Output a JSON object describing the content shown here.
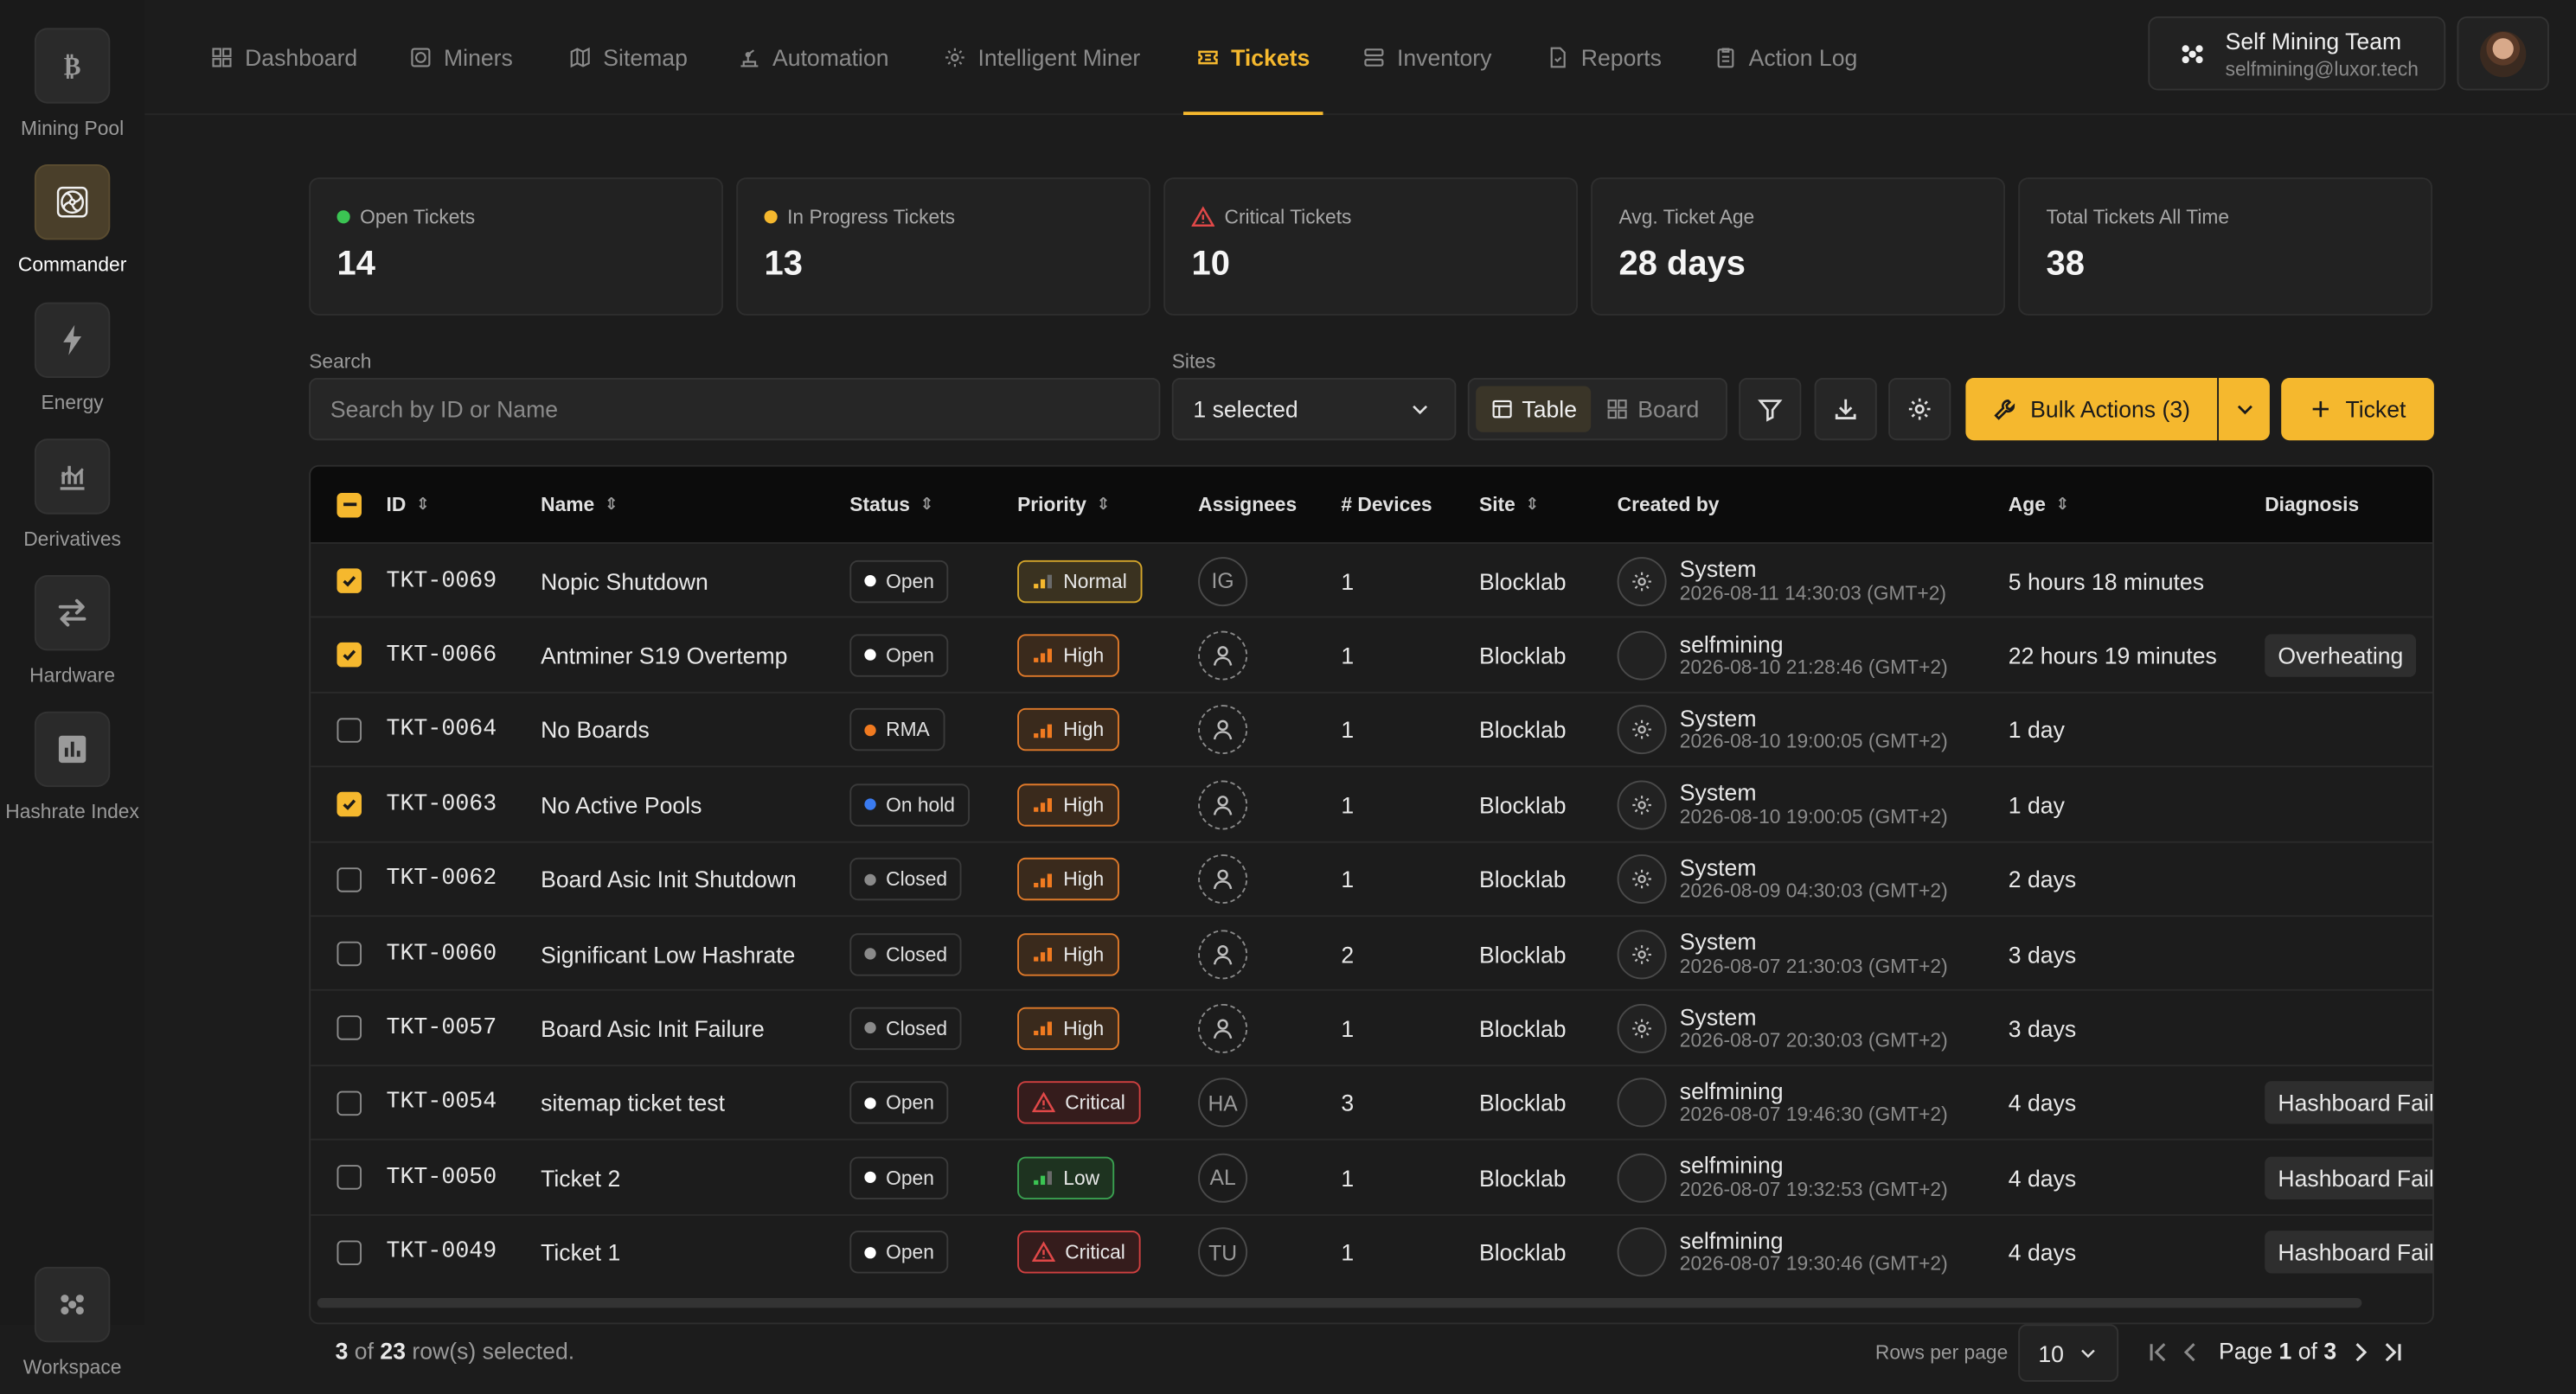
{
  "sidebar": {
    "items": [
      {
        "label": "Mining Pool",
        "icon": "bitcoin-icon"
      },
      {
        "label": "Commander",
        "icon": "fan-icon",
        "active": true
      },
      {
        "label": "Energy",
        "icon": "lightning-icon"
      },
      {
        "label": "Derivatives",
        "icon": "derivatives-chart-icon"
      },
      {
        "label": "Hardware",
        "icon": "swap-arrows-icon"
      },
      {
        "label": "Hashrate Index",
        "icon": "bar-chart-icon"
      }
    ],
    "workspace_label": "Workspace"
  },
  "nav": {
    "items": [
      "Dashboard",
      "Miners",
      "Sitemap",
      "Automation",
      "Intelligent Miner",
      "Tickets",
      "Inventory",
      "Reports",
      "Action Log"
    ],
    "active": "Tickets"
  },
  "account": {
    "team": "Self Mining Team",
    "email": "selfmining@luxor.tech"
  },
  "stats": [
    {
      "label": "Open Tickets",
      "value": "14",
      "color": "#3bc453"
    },
    {
      "label": "In Progress Tickets",
      "value": "13",
      "color": "#f5b82e"
    },
    {
      "label": "Critical Tickets",
      "value": "10",
      "color": "#e04848"
    },
    {
      "label": "Avg. Ticket Age",
      "value": "28 days"
    },
    {
      "label": "Total Tickets All Time",
      "value": "38"
    }
  ],
  "filters": {
    "search_label": "Search",
    "search_placeholder": "Search by ID or Name",
    "search_value": "",
    "sites_label": "Sites",
    "sites_value": "1 selected"
  },
  "toolbar": {
    "view_table": "Table",
    "view_board": "Board",
    "bulk_actions": "Bulk Actions (3)",
    "new_ticket": "Ticket"
  },
  "table": {
    "columns": [
      "ID",
      "Name",
      "Status",
      "Priority",
      "Assignees",
      "# Devices",
      "Site",
      "Created by",
      "Age",
      "Diagnosis"
    ],
    "rows": [
      {
        "checked": true,
        "id": "TKT-0069",
        "name": "Nopic Shutdown",
        "status": "Open",
        "priority": "Normal",
        "assignee": "IG",
        "devices": "1",
        "site": "Blocklab",
        "creator": "System",
        "created": "2026-08-11 14:30:03 (GMT+2)",
        "age": "5 hours 18 minutes",
        "diagnosis": ""
      },
      {
        "checked": true,
        "id": "TKT-0066",
        "name": "Antminer S19 Overtemp",
        "status": "Open",
        "priority": "High",
        "assignee": "",
        "devices": "1",
        "site": "Blocklab",
        "creator": "selfmining",
        "created": "2026-08-10 21:28:46 (GMT+2)",
        "age": "22 hours 19 minutes",
        "diagnosis": "Overheating"
      },
      {
        "checked": false,
        "id": "TKT-0064",
        "name": "No Boards",
        "status": "RMA",
        "priority": "High",
        "assignee": "",
        "devices": "1",
        "site": "Blocklab",
        "creator": "System",
        "created": "2026-08-10 19:00:05 (GMT+2)",
        "age": "1 day",
        "diagnosis": ""
      },
      {
        "checked": true,
        "id": "TKT-0063",
        "name": "No Active Pools",
        "status": "On hold",
        "priority": "High",
        "assignee": "",
        "devices": "1",
        "site": "Blocklab",
        "creator": "System",
        "created": "2026-08-10 19:00:05 (GMT+2)",
        "age": "1 day",
        "diagnosis": ""
      },
      {
        "checked": false,
        "id": "TKT-0062",
        "name": "Board Asic Init Shutdown",
        "status": "Closed",
        "priority": "High",
        "assignee": "",
        "devices": "1",
        "site": "Blocklab",
        "creator": "System",
        "created": "2026-08-09 04:30:03 (GMT+2)",
        "age": "2 days",
        "diagnosis": ""
      },
      {
        "checked": false,
        "id": "TKT-0060",
        "name": "Significant Low Hashrate",
        "status": "Closed",
        "priority": "High",
        "assignee": "",
        "devices": "2",
        "site": "Blocklab",
        "creator": "System",
        "created": "2026-08-07 21:30:03 (GMT+2)",
        "age": "3 days",
        "diagnosis": ""
      },
      {
        "checked": false,
        "id": "TKT-0057",
        "name": "Board Asic Init Failure",
        "status": "Closed",
        "priority": "High",
        "assignee": "",
        "devices": "1",
        "site": "Blocklab",
        "creator": "System",
        "created": "2026-08-07 20:30:03 (GMT+2)",
        "age": "3 days",
        "diagnosis": ""
      },
      {
        "checked": false,
        "id": "TKT-0054",
        "name": "sitemap ticket test",
        "status": "Open",
        "priority": "Critical",
        "assignee": "HA",
        "devices": "3",
        "site": "Blocklab",
        "creator": "selfmining",
        "created": "2026-08-07 19:46:30 (GMT+2)",
        "age": "4 days",
        "diagnosis": "Hashboard Fail"
      },
      {
        "checked": false,
        "id": "TKT-0050",
        "name": "Ticket 2",
        "status": "Open",
        "priority": "Low",
        "assignee": "AL",
        "devices": "1",
        "site": "Blocklab",
        "creator": "selfmining",
        "created": "2026-08-07 19:32:53 (GMT+2)",
        "age": "4 days",
        "diagnosis": "Hashboard Fail"
      },
      {
        "checked": false,
        "id": "TKT-0049",
        "name": "Ticket 1",
        "status": "Open",
        "priority": "Critical",
        "assignee": "TU",
        "devices": "1",
        "site": "Blocklab",
        "creator": "selfmining",
        "created": "2026-08-07 19:30:46 (GMT+2)",
        "age": "4 days",
        "diagnosis": "Hashboard Fail"
      }
    ]
  },
  "footer": {
    "selected": "3",
    "of_text": "of",
    "total": "23",
    "selected_suffix": "row(s) selected.",
    "rows_per_page_label": "Rows per page",
    "rows_per_page": "10",
    "page_word": "Page",
    "page": "1",
    "page_of": "of",
    "pages": "3"
  },
  "status_colors": {
    "Open": "#ffffff",
    "RMA": "#f07a20",
    "On hold": "#3a7bf0",
    "Closed": "#8a8a8a"
  }
}
